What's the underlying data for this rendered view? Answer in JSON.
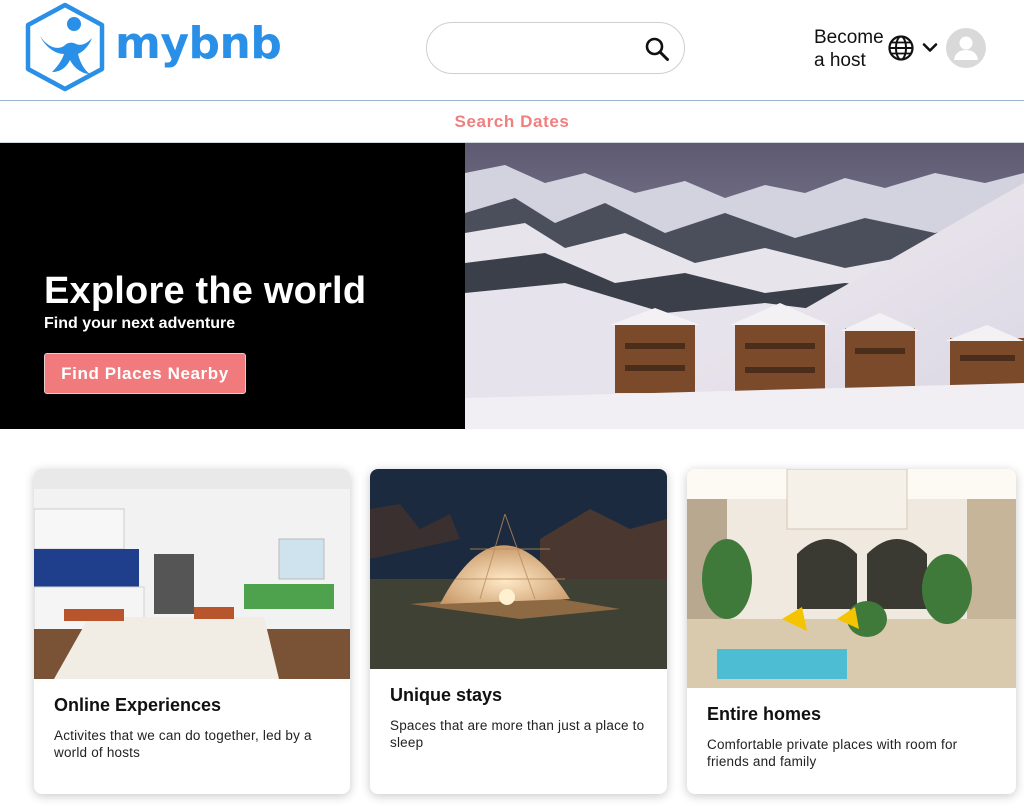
{
  "header": {
    "brand": "mybnb",
    "search": {
      "placeholder": ""
    },
    "host_link": "Become a host"
  },
  "icons": {
    "logo": "person-hexagon-logo",
    "search": "search-icon",
    "language": "globe-icon",
    "menu": "chevron-down-icon",
    "account": "user-avatar-icon"
  },
  "dates_bar": {
    "label": "Search Dates"
  },
  "hero": {
    "title": "Explore the world",
    "subtitle": "Find your next adventure",
    "cta": "Find Places Nearby"
  },
  "cards": [
    {
      "title": "Online Experiences",
      "description": "Activites that we can do together, led by a world of hosts"
    },
    {
      "title": "Unique stays",
      "description": "Spaces that are more than just a place to sleep"
    },
    {
      "title": "Entire homes",
      "description": "Comfortable private places with room for friends and family"
    }
  ],
  "colors": {
    "brand": "#2a8fe6",
    "accent": "#f07a7c",
    "hero_bg": "#000000"
  }
}
